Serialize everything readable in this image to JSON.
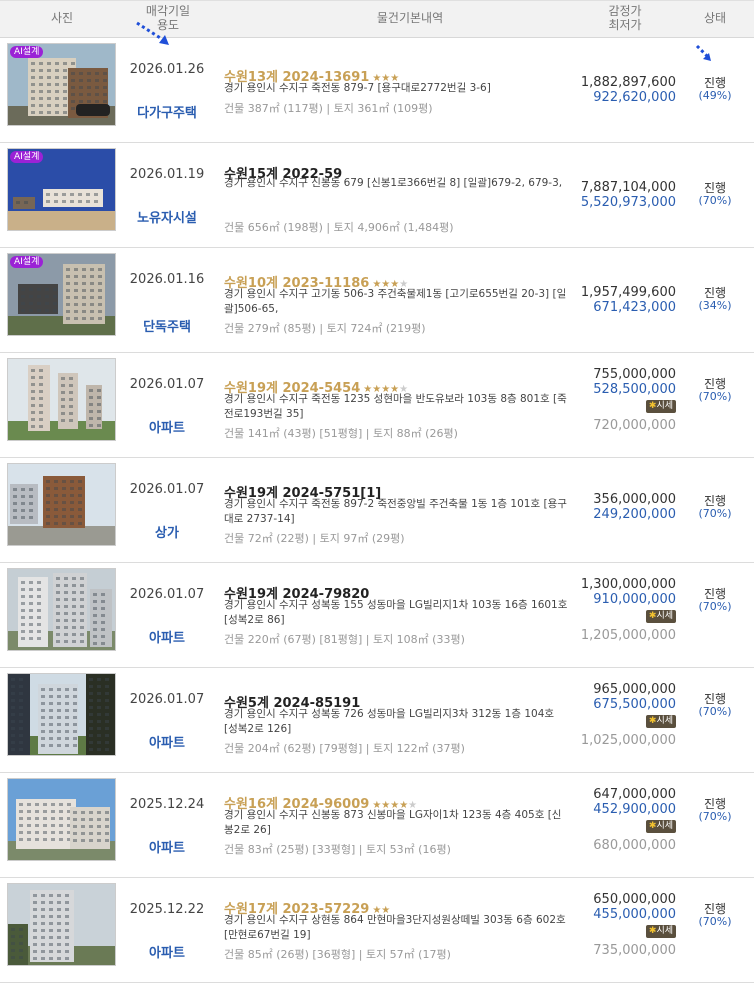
{
  "header": {
    "photo": "사진",
    "date_line1": "매각기일",
    "date_line2": "용도",
    "info": "물건기본내역",
    "price_line1": "감정가",
    "price_line2": "최저가",
    "status": "상태"
  },
  "badges": {
    "ai": "AI설계",
    "market": "시세"
  },
  "rows": [
    {
      "date": "2026.01.26",
      "type": "다가구주택",
      "case": "수원13계 2024-13691",
      "stars": "★★★",
      "stars_off": "",
      "addr": "경기 용인시 수지구 죽전동 879-7 [용구대로2772번길 3-6]",
      "info": "건물 387㎡ (117평)  |  토지 361㎡ (109평)",
      "price": "1,882,897,600",
      "low": "922,620,000",
      "status": "진행",
      "pct": "(49%)"
    },
    {
      "date": "2026.01.19",
      "type": "노유자시설",
      "case": "수원15계 2022-59",
      "stars": "",
      "stars_off": "",
      "addr": "경기 용인시 수지구 신봉동 679 [신봉1로366번길 8] [일괄]679-2, 679-3,",
      "info": "건물 656㎡ (198평)  |  토지 4,906㎡ (1,484평)",
      "price": "7,887,104,000",
      "low": "5,520,973,000",
      "status": "진행",
      "pct": "(70%)"
    },
    {
      "date": "2026.01.16",
      "type": "단독주택",
      "case": "수원10계 2023-11186",
      "stars": "★★★",
      "stars_off": "★",
      "addr": "경기 용인시 수지구 고기동 506-3 주건축물제1동 [고기로655번길 20-3] [일괄]506-65,",
      "info": "건물 279㎡ (85평)  |  토지 724㎡ (219평)",
      "price": "1,957,499,600",
      "low": "671,423,000",
      "status": "진행",
      "pct": "(34%)"
    },
    {
      "date": "2026.01.07",
      "type": "아파트",
      "case": "수원19계 2024-5454",
      "stars": "★★★★",
      "stars_off": "★",
      "addr": "경기 용인시 수지구 죽전동 1235 성현마을 반도유보라 103동 8층 801호 [죽전로193번길 35]",
      "info": "건물 141㎡ (43평) [51평형]  |  토지 88㎡ (26평)",
      "price": "755,000,000",
      "low": "528,500,000",
      "market": "720,000,000",
      "status": "진행",
      "pct": "(70%)"
    },
    {
      "date": "2026.01.07",
      "type": "상가",
      "case": "수원19계 2024-5751[1]",
      "stars": "",
      "stars_off": "",
      "addr": "경기 용인시 수지구 죽전동 897-2 죽전중앙빌 주건축물 1동 1층 101호 [용구대로 2737-14]",
      "info": "건물 72㎡ (22평)  |  토지 97㎡ (29평)",
      "price": "356,000,000",
      "low": "249,200,000",
      "status": "진행",
      "pct": "(70%)"
    },
    {
      "date": "2026.01.07",
      "type": "아파트",
      "case": "수원19계 2024-79820",
      "stars": "",
      "stars_off": "",
      "addr": "경기 용인시 수지구 성복동 155 성동마을 LG빌리지1차 103동 16층 1601호 [성복2로 86]",
      "info": "건물 220㎡ (67평) [81평형]  |  토지 108㎡ (33평)",
      "price": "1,300,000,000",
      "low": "910,000,000",
      "market": "1,205,000,000",
      "status": "진행",
      "pct": "(70%)"
    },
    {
      "date": "2026.01.07",
      "type": "아파트",
      "case": "수원5계 2024-85191",
      "stars": "",
      "stars_off": "",
      "addr": "경기 용인시 수지구 성복동 726 성동마을 LG빌리지3차 312동 1층 104호 [성복2로 126]",
      "info": "건물 204㎡ (62평) [79평형]  |  토지 122㎡ (37평)",
      "price": "965,000,000",
      "low": "675,500,000",
      "market": "1,025,000,000",
      "status": "진행",
      "pct": "(70%)"
    },
    {
      "date": "2025.12.24",
      "type": "아파트",
      "case": "수원16계 2024-96009",
      "stars": "★★★★",
      "stars_off": "★",
      "addr": "경기 용인시 수지구 신봉동 873 신봉마을 LG자이1차 123동 4층 405호 [신봉2로 26]",
      "info": "건물 83㎡ (25평) [33평형]  |  토지 53㎡ (16평)",
      "price": "647,000,000",
      "low": "452,900,000",
      "market": "680,000,000",
      "status": "진행",
      "pct": "(70%)"
    },
    {
      "date": "2025.12.22",
      "type": "아파트",
      "case": "수원17계 2023-57229",
      "stars": "★★",
      "stars_off": "",
      "addr": "경기 용인시 수지구 상현동 864 만현마을3단지성원상떼빌 303동 6층 602호 [만현로67번길 19]",
      "info": "건물 85㎡ (26평) [36평형]  |  토지 57㎡ (17평)",
      "price": "650,000,000",
      "low": "455,000,000",
      "market": "735,000,000",
      "status": "진행",
      "pct": "(70%)"
    }
  ],
  "colors": {
    "accent_gold": "#c8a055",
    "accent_blue": "#2a5db0",
    "ai_badge": "#9b22d6"
  }
}
